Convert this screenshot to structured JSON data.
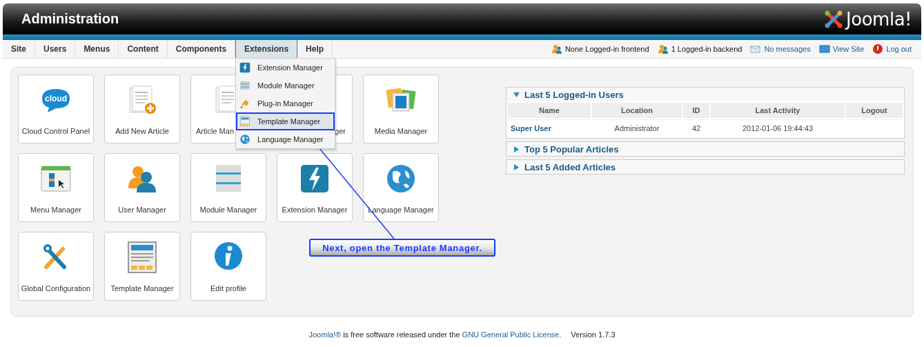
{
  "header": {
    "title": "Administration",
    "logo_text": "Joomla!"
  },
  "menu": [
    {
      "label": "Site",
      "selected": false
    },
    {
      "label": "Users",
      "selected": false
    },
    {
      "label": "Menus",
      "selected": false
    },
    {
      "label": "Content",
      "selected": false
    },
    {
      "label": "Components",
      "selected": false
    },
    {
      "label": "Extensions",
      "selected": true,
      "dropdown": [
        {
          "label": "Extension Manager",
          "selected": false
        },
        {
          "label": "Module Manager",
          "selected": false
        },
        {
          "label": "Plug-in Manager",
          "selected": false
        },
        {
          "label": "Template Manager",
          "selected": true
        },
        {
          "label": "Language Manager",
          "selected": false
        }
      ]
    },
    {
      "label": "Help",
      "selected": false
    }
  ],
  "status": [
    {
      "label": "None Logged-in frontend",
      "kind": "users"
    },
    {
      "label": "1 Logged-in backend",
      "kind": "users"
    },
    {
      "label": "No messages",
      "kind": "messages"
    },
    {
      "label": "View Site",
      "kind": "site"
    },
    {
      "label": "Log out",
      "kind": "logout"
    }
  ],
  "tiles": [
    {
      "label": "Cloud Control Panel",
      "icon_text": "cloud"
    },
    {
      "label": "Add New Article"
    },
    {
      "label": "Article Man"
    },
    {
      "label": "ger"
    },
    {
      "label": "Media Manager"
    },
    {
      "label": "Menu Manager"
    },
    {
      "label": "User Manager"
    },
    {
      "label": "Module Manager"
    },
    {
      "label": "Extension Manager"
    },
    {
      "label": "Language Manager"
    },
    {
      "label": "Global Configuration"
    },
    {
      "label": "Template Manager"
    },
    {
      "label": "Edit profile"
    }
  ],
  "panels": [
    {
      "title": "Last 5 Logged-in Users",
      "expanded": true,
      "table": {
        "columns": [
          "Name",
          "Location",
          "ID",
          "Last Activity",
          "Logout"
        ],
        "rows": [
          [
            "Super User",
            "Administrator",
            "42",
            "2012-01-06 19:44:43",
            ""
          ]
        ]
      }
    },
    {
      "title": "Top 5 Popular Articles",
      "expanded": false
    },
    {
      "title": "Last 5 Added Articles",
      "expanded": false
    }
  ],
  "callout": "Next, open the Template Manager.",
  "footer": {
    "link1": "Joomla!®",
    "text": " is free software released under the ",
    "link2": "GNU General Public License",
    "end": ".",
    "version": "Version 1.7.3"
  }
}
